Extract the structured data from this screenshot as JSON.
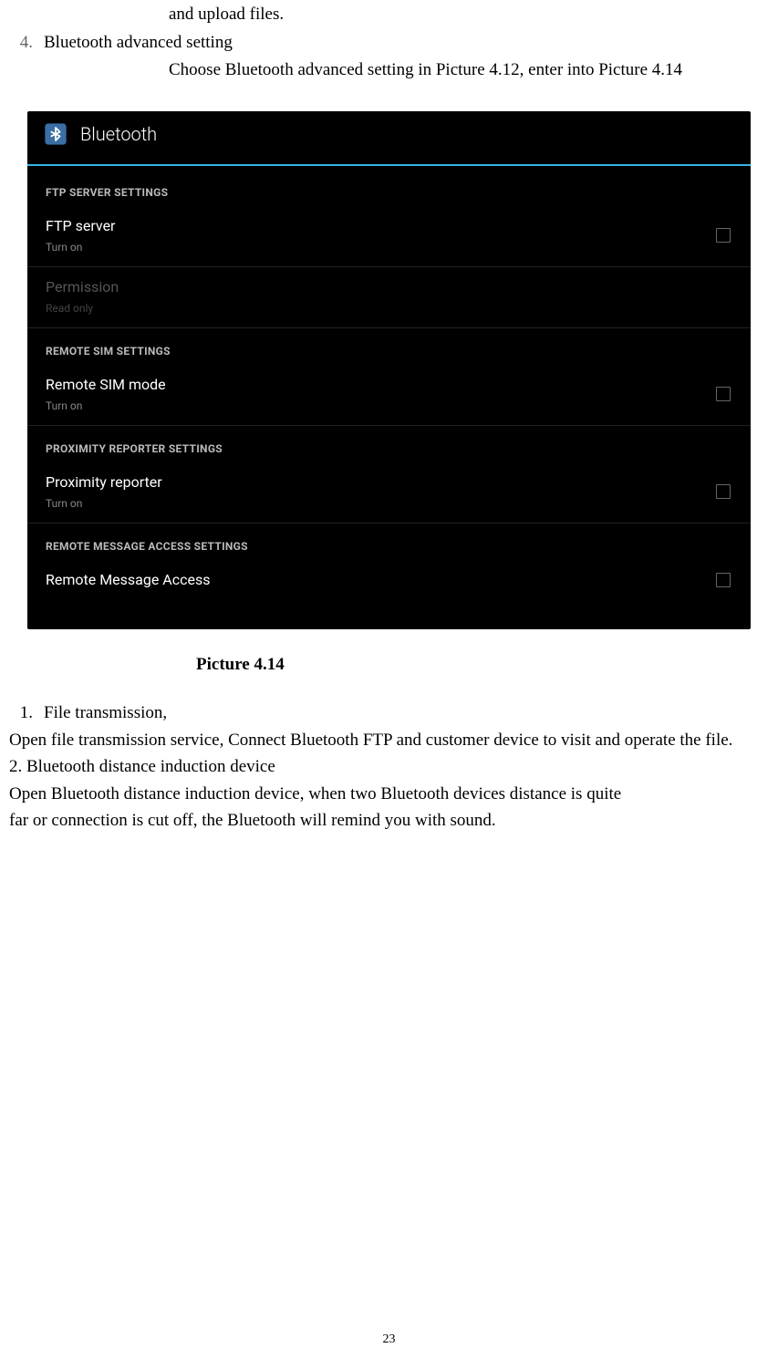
{
  "intro": {
    "line0": "and upload files.",
    "item4_num": "4.",
    "item4_text": "Bluetooth advanced setting",
    "item4_desc": "Choose Bluetooth advanced setting in Picture 4.12, enter into Picture 4.14"
  },
  "screenshot": {
    "header_title": "Bluetooth",
    "sections": [
      {
        "header": "FTP SERVER SETTINGS",
        "rows": [
          {
            "label": "FTP server",
            "sub": "Turn on",
            "checkbox": true,
            "disabled": false
          },
          {
            "label": "Permission",
            "sub": "Read only",
            "checkbox": false,
            "disabled": true
          }
        ]
      },
      {
        "header": "REMOTE SIM SETTINGS",
        "rows": [
          {
            "label": "Remote SIM mode",
            "sub": "Turn on",
            "checkbox": true,
            "disabled": false
          }
        ]
      },
      {
        "header": "PROXIMITY REPORTER SETTINGS",
        "rows": [
          {
            "label": "Proximity reporter",
            "sub": "Turn on",
            "checkbox": true,
            "disabled": false
          }
        ]
      },
      {
        "header": "REMOTE MESSAGE ACCESS SETTINGS",
        "rows": [
          {
            "label": "Remote Message Access",
            "sub": "",
            "checkbox": true,
            "disabled": false
          }
        ]
      }
    ]
  },
  "caption": "Picture 4.14",
  "body": {
    "item1_num": "1.",
    "item1_text": "File transmission,",
    "p1": "Open file transmission service, Connect Bluetooth FTP and customer device to visit and operate the file.",
    "p2": "2. Bluetooth distance induction device",
    "p3": "Open Bluetooth distance induction device, when two Bluetooth devices distance is quite",
    "p4": "far or connection is cut off, the Bluetooth will remind you with sound."
  },
  "page_number": "23"
}
